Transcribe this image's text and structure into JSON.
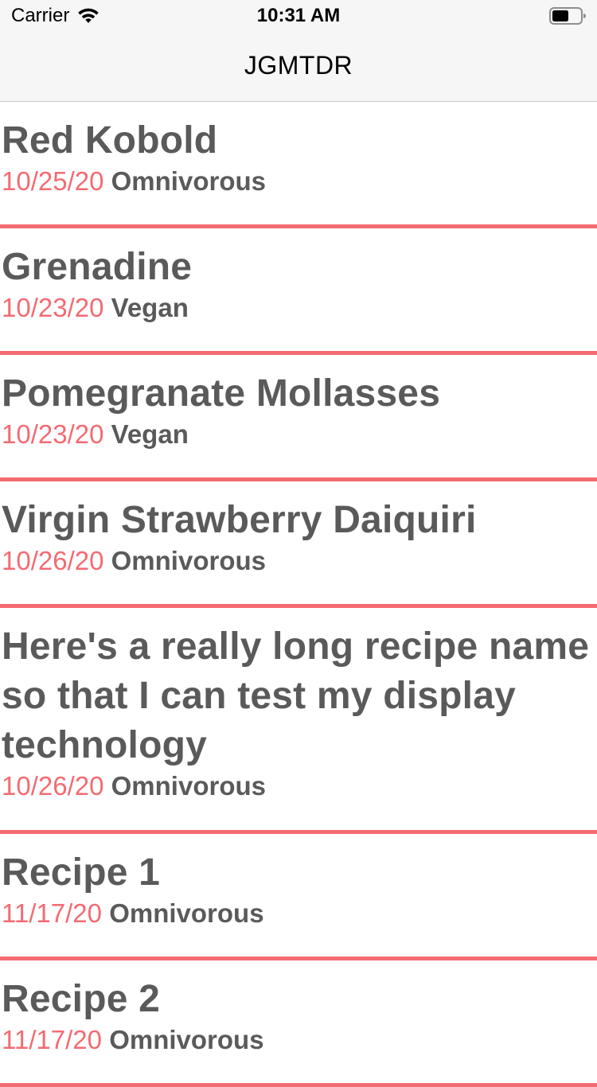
{
  "status_bar": {
    "carrier": "Carrier",
    "time": "10:31 AM",
    "wifi_icon": "wifi-icon",
    "battery_icon": "battery-icon"
  },
  "nav": {
    "title": "JGMTDR"
  },
  "colors": {
    "accent": "#f36b72",
    "text": "#5a5a5a",
    "bar_bg": "#f6f6f6"
  },
  "recipes": [
    {
      "name": "Red Kobold",
      "date": "10/25/20",
      "diet": "Omnivorous"
    },
    {
      "name": "Grenadine",
      "date": "10/23/20",
      "diet": "Vegan"
    },
    {
      "name": "Pomegranate Mollasses",
      "date": "10/23/20",
      "diet": "Vegan"
    },
    {
      "name": "Virgin Strawberry Daiquiri",
      "date": "10/26/20",
      "diet": "Omnivorous"
    },
    {
      "name": "Here's a really long recipe name so that I can test my display technology",
      "date": "10/26/20",
      "diet": "Omnivorous"
    },
    {
      "name": "Recipe 1",
      "date": "11/17/20",
      "diet": "Omnivorous"
    },
    {
      "name": "Recipe 2",
      "date": "11/17/20",
      "diet": "Omnivorous"
    }
  ]
}
